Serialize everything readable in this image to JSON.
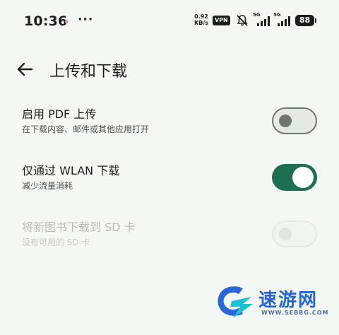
{
  "status_bar": {
    "time": "10:36",
    "more": "···",
    "net_speed_value": "0.92",
    "net_speed_unit": "KB/s",
    "vpn": "VPN",
    "sim1_label": "5G",
    "sim2_label": "5G",
    "battery": "88"
  },
  "header": {
    "title": "上传和下载"
  },
  "settings": [
    {
      "title": "启用 PDF 上传",
      "summary": "在下载内容、邮件或其他应用打开",
      "enabled": false
    },
    {
      "title": "仅通过 WLAN 下载",
      "summary": "减少流量消耗",
      "enabled": true
    },
    {
      "title": "将新图书下载到 SD 卡",
      "summary": "没有可用的 SD 卡",
      "enabled": false,
      "disabled": true
    }
  ],
  "watermark": {
    "name": "速游网",
    "url": "WWW.SEBBG.COM"
  },
  "colors": {
    "background": "#f3f8f4",
    "accent": "#1e6e52",
    "switch_off": "#6e7671"
  }
}
